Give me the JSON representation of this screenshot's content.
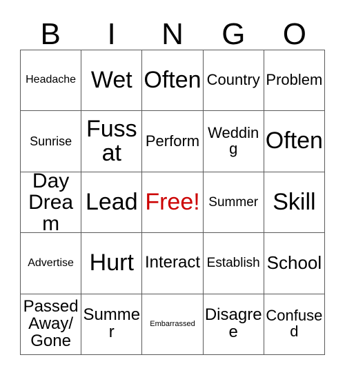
{
  "card": {
    "header_letters": [
      "B",
      "I",
      "N",
      "G",
      "O"
    ],
    "free_color": "#cc0000",
    "grid_color": "#5a5a5a",
    "background": "#ffffff",
    "rows": [
      [
        {
          "text": "Headache",
          "size": "s-sm"
        },
        {
          "text": "Wet",
          "size": "s-xxl"
        },
        {
          "text": "Often",
          "size": "s-xxl"
        },
        {
          "text": "Country",
          "size": "s-md2"
        },
        {
          "text": "Problem",
          "size": "s-md2"
        }
      ],
      [
        {
          "text": "Sunrise",
          "size": "s-sm2"
        },
        {
          "text": "Fuss\nat",
          "size": "s-xxl"
        },
        {
          "text": "Perform",
          "size": "s-md2"
        },
        {
          "text": "Wedding",
          "size": "s-md2"
        },
        {
          "text": "Often",
          "size": "s-xxl"
        }
      ],
      [
        {
          "text": "Day\nDream",
          "size": "s-xl"
        },
        {
          "text": "Lead",
          "size": "s-xxl"
        },
        {
          "text": "Free!",
          "size": "free"
        },
        {
          "text": "Summer",
          "size": "s-md"
        },
        {
          "text": "Skill",
          "size": "s-xxl"
        }
      ],
      [
        {
          "text": "Advertise",
          "size": "s-sm"
        },
        {
          "text": "Hurt",
          "size": "s-xxl"
        },
        {
          "text": "Interact",
          "size": "s-lg"
        },
        {
          "text": "Establish",
          "size": "s-md"
        },
        {
          "text": "School",
          "size": "s-lg2"
        }
      ],
      [
        {
          "text": "Passed\nAway/\nGone",
          "size": "s-lg"
        },
        {
          "text": "Summer",
          "size": "s-lg"
        },
        {
          "text": "Embarrassed",
          "size": "s-xs"
        },
        {
          "text": "Disagree",
          "size": "s-lg"
        },
        {
          "text": "Confused",
          "size": "s-md2"
        }
      ]
    ]
  }
}
